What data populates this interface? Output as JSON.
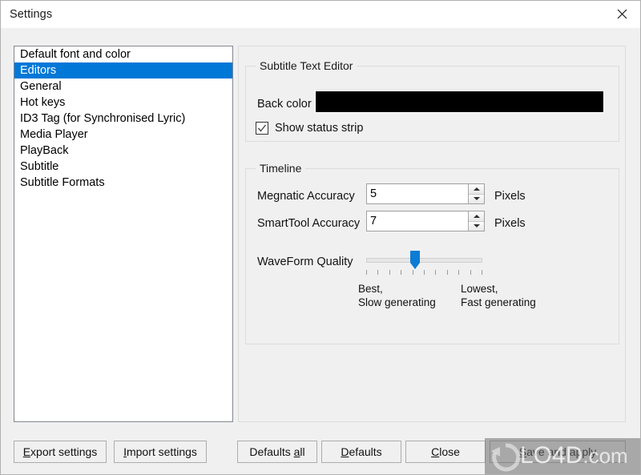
{
  "window": {
    "title": "Settings",
    "close_icon": "close-icon"
  },
  "sidebar": {
    "items": [
      {
        "label": "Default font and color",
        "selected": false
      },
      {
        "label": "Editors",
        "selected": true
      },
      {
        "label": "General",
        "selected": false
      },
      {
        "label": "Hot keys",
        "selected": false
      },
      {
        "label": "ID3 Tag (for Synchronised Lyric)",
        "selected": false
      },
      {
        "label": "Media Player",
        "selected": false
      },
      {
        "label": "PlayBack",
        "selected": false
      },
      {
        "label": "Subtitle",
        "selected": false
      },
      {
        "label": "Subtitle Formats",
        "selected": false
      }
    ],
    "selection_color": "#0078d7"
  },
  "editor_group": {
    "title": "Subtitle Text Editor",
    "back_color_label": "Back color",
    "back_color_value": "#000000",
    "show_status_strip_label": "Show status strip",
    "show_status_strip_checked": true
  },
  "timeline_group": {
    "title": "Timeline",
    "magnetic": {
      "label": "Megnatic Accuracy",
      "value": "5",
      "unit": "Pixels"
    },
    "smarttool": {
      "label": "SmartTool Accuracy",
      "value": "7",
      "unit": "Pixels"
    },
    "waveform": {
      "label": "WaveForm Quality",
      "left_caption_line1": "Best,",
      "left_caption_line2": "Slow generating",
      "right_caption_line1": "Lowest,",
      "right_caption_line2": "Fast generating",
      "thumb_position_percent": 41,
      "tick_count": 11,
      "thumb_color": "#0c7cd5"
    }
  },
  "footer": {
    "export_settings": {
      "pre": "",
      "mnemonic": "E",
      "post": "xport settings"
    },
    "import_settings": {
      "pre": "",
      "mnemonic": "I",
      "post": "mport settings"
    },
    "defaults_all": {
      "pre": "Defaults ",
      "mnemonic": "a",
      "post": "ll"
    },
    "defaults": {
      "pre": "",
      "mnemonic": "D",
      "post": "efaults"
    },
    "close": {
      "pre": "",
      "mnemonic": "C",
      "post": "lose"
    },
    "save_and_apply": {
      "pre": "",
      "mnemonic": "S",
      "post": "ave and apply"
    }
  },
  "watermark": {
    "text": "LO4D",
    "suffix": ".com",
    "logo_icon": "refresh-circle-icon"
  }
}
